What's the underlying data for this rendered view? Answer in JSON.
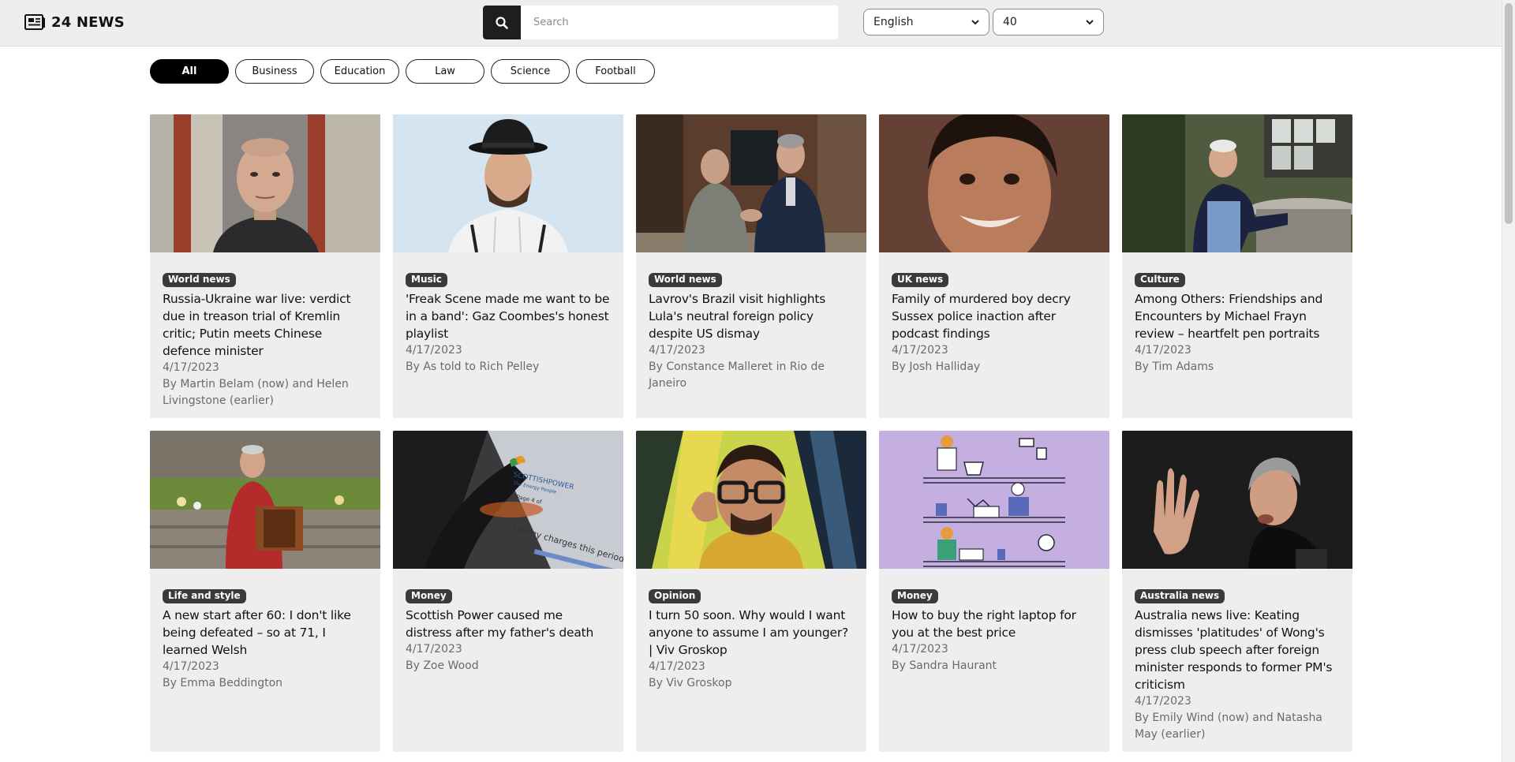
{
  "header": {
    "logo_text": "24 NEWS",
    "search_placeholder": "Search",
    "language_selected": "English",
    "count_selected": "40"
  },
  "filters": {
    "items": [
      "All",
      "Business",
      "Education",
      "Law",
      "Science",
      "Football"
    ],
    "active": "All"
  },
  "articles": [
    {
      "category": "World news",
      "title": "Russia-Ukraine war live: verdict due in treason trial of Kremlin critic; Putin meets Chinese defence minister",
      "date": "4/17/2023",
      "author": "By Martin Belam (now) and Helen Livingstone (earlier)"
    },
    {
      "category": "Music",
      "title": "'Freak Scene made me want to be in a band': Gaz Coombes's honest playlist",
      "date": "4/17/2023",
      "author": "By As told to Rich Pelley"
    },
    {
      "category": "World news",
      "title": "Lavrov's Brazil visit highlights Lula's neutral foreign policy despite US dismay",
      "date": "4/17/2023",
      "author": "By Constance Malleret in Rio de Janeiro"
    },
    {
      "category": "UK news",
      "title": "Family of murdered boy decry Sussex police inaction after podcast findings",
      "date": "4/17/2023",
      "author": "By Josh Halliday"
    },
    {
      "category": "Culture",
      "title": "Among Others: Friendships and Encounters by Michael Frayn review – heartfelt pen portraits",
      "date": "4/17/2023",
      "author": "By Tim Adams"
    },
    {
      "category": "Life and style",
      "title": "A new start after 60: I don't like being defeated – so at 71, I learned Welsh",
      "date": "4/17/2023",
      "author": "By Emma Beddington"
    },
    {
      "category": "Money",
      "title": "Scottish Power caused me distress after my father's death",
      "date": "4/17/2023",
      "author": "By Zoe Wood"
    },
    {
      "category": "Opinion",
      "title": "I turn 50 soon. Why would I want anyone to assume I am younger? | Viv Groskop",
      "date": "4/17/2023",
      "author": "By Viv Groskop"
    },
    {
      "category": "Money",
      "title": "How to buy the right laptop for you at the best price",
      "date": "4/17/2023",
      "author": "By Sandra Haurant"
    },
    {
      "category": "Australia news",
      "title": "Australia news live: Keating dismisses 'platitudes' of Wong's press club speech after foreign minister responds to former PM's criticism",
      "date": "4/17/2023",
      "author": "By Emily Wind (now) and Natasha May (earlier)"
    }
  ],
  "image_texts": {
    "scottishpower_logo": "SCOTTISHPOWER",
    "scottishpower_sub": "The Energy People",
    "bill_page": "Page 4 of",
    "bill_line": "Energy charges this period"
  }
}
